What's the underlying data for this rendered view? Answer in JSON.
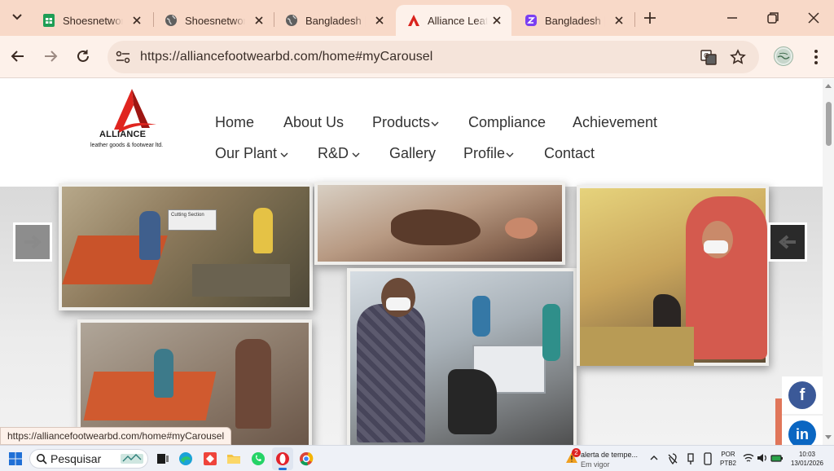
{
  "browser": {
    "tabs": [
      {
        "label": "Shoesnetwork",
        "icon": "sheets-icon"
      },
      {
        "label": "Shoesnetwork",
        "icon": "globe-icon"
      },
      {
        "label": "Bangladesh |",
        "icon": "globe-icon"
      },
      {
        "label": "Alliance Leather",
        "icon": "alliance-icon",
        "active": true
      },
      {
        "label": "Bangladesh |",
        "icon": "purple-app-icon"
      }
    ],
    "url": "https://alliancefootwearbd.com/home#myCarousel",
    "status_url": "https://alliancefootwearbd.com/home#myCarousel"
  },
  "site": {
    "logo_text": "ALLIANCE",
    "logo_tagline": "leather goods & footwear ltd.",
    "nav_row1": [
      "Home",
      "About Us",
      "Products",
      "Compliance",
      "Achievement"
    ],
    "nav_row2": [
      "Our Plant",
      "R&D",
      "Gallery",
      "Profile",
      "Contact"
    ],
    "cutting_sign": "Cutting Section",
    "social": [
      "facebook-icon",
      "linkedin-icon"
    ]
  },
  "taskbar": {
    "search_label": "Pesquisar",
    "weather_badge": "2",
    "weather_title": "alerta de tempe...",
    "weather_sub": "Em vigor",
    "lang_top": "POR",
    "lang_bottom": "PTB2",
    "time": "10:03",
    "date": "13/01/2026"
  },
  "colors": {
    "tabstrip": "#f8d9c8",
    "toolbar": "#fdf1ea",
    "alliance_red": "#d9231d",
    "facebook": "#3b5998",
    "linkedin": "#0a66c2"
  }
}
